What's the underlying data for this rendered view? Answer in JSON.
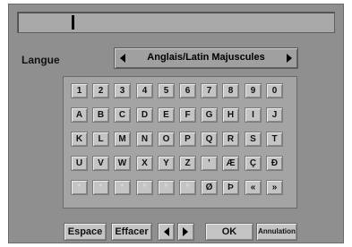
{
  "language": {
    "label": "Langue",
    "value": "Anglais/Latin Majuscules",
    "prev_icon": "triangle-left-icon",
    "next_icon": "triangle-right-icon"
  },
  "text_input": {
    "value": ""
  },
  "keyboard": {
    "rows": [
      [
        "1",
        "2",
        "3",
        "4",
        "5",
        "6",
        "7",
        "8",
        "9",
        "0"
      ],
      [
        "A",
        "B",
        "C",
        "D",
        "E",
        "F",
        "G",
        "H",
        "I",
        "J"
      ],
      [
        "K",
        "L",
        "M",
        "N",
        "O",
        "P",
        "Q",
        "R",
        "S",
        "T"
      ],
      [
        "U",
        "V",
        "W",
        "X",
        "Y",
        "Z",
        "'",
        "Æ",
        "Ç",
        "Ð"
      ],
      [
        "*",
        "*",
        "*",
        "*",
        "*",
        "*",
        "Ø",
        "Þ",
        "«",
        "»"
      ]
    ]
  },
  "buttons": {
    "space": "Espace",
    "delete": "Effacer",
    "cursor_left_icon": "triangle-left-icon",
    "cursor_right_icon": "triangle-right-icon",
    "ok": "OK",
    "cancel": "Annulation"
  }
}
